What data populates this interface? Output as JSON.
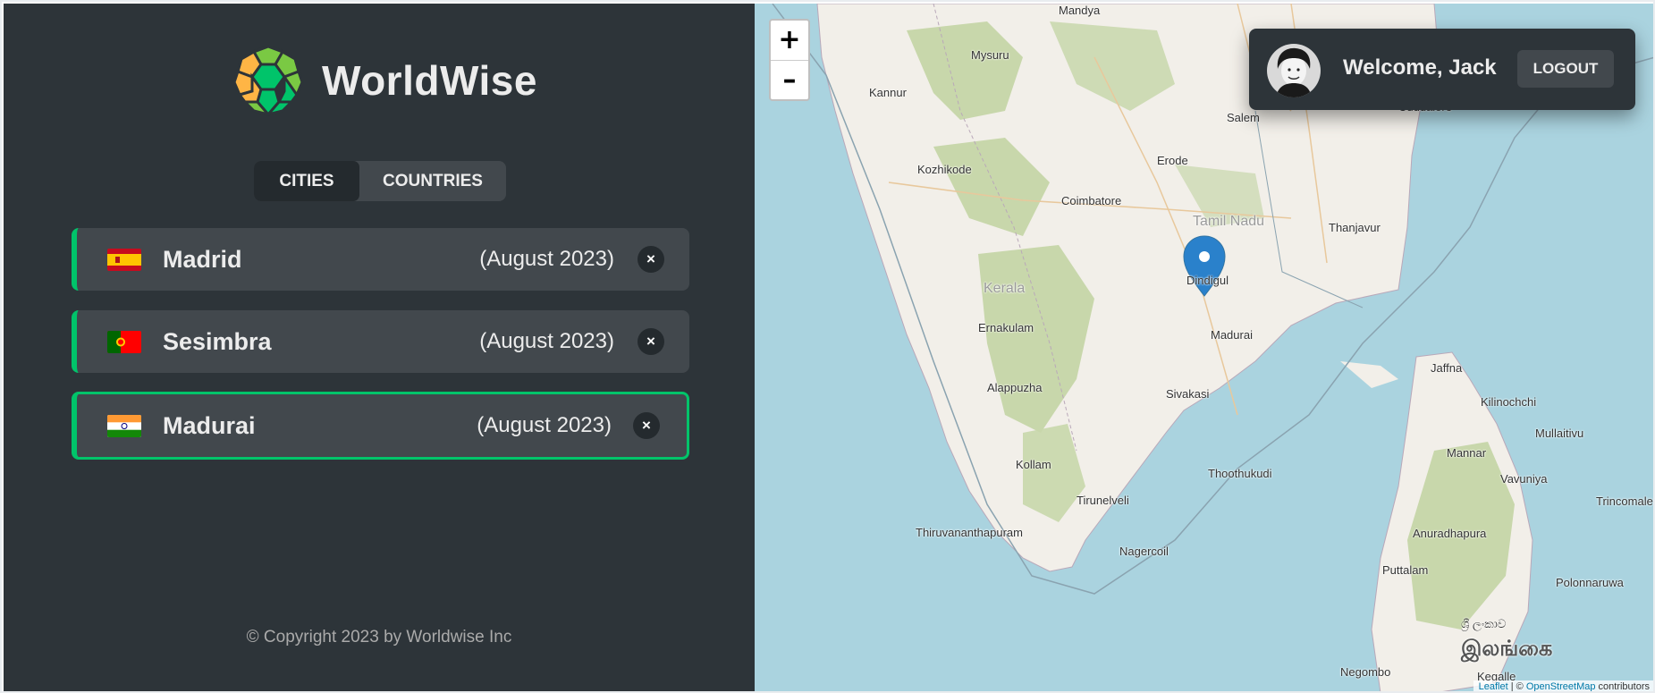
{
  "app": {
    "name": "WorldWise"
  },
  "tabs": [
    {
      "label": "Cities"
    },
    {
      "label": "Countries"
    }
  ],
  "cities": [
    {
      "name": "Madrid",
      "date": "(August 2023)",
      "delete": "×"
    },
    {
      "name": "Sesimbra",
      "date": "(August 2023)",
      "delete": "×"
    },
    {
      "name": "Madurai",
      "date": "(August 2023)",
      "delete": "×"
    }
  ],
  "footer": {
    "copyright": "© Copyright 2023 by Worldwise Inc"
  },
  "map": {
    "zoom_in": "+",
    "zoom_out": "–",
    "labels": [
      "Mandya",
      "Mysuru",
      "Kannur",
      "Salem",
      "Erode",
      "Kozhikode",
      "Coimbatore",
      "Tamil Nadu",
      "Thanjavur",
      "Kerala",
      "Dindigul",
      "Ernakulam",
      "Madurai",
      "Alappuzha",
      "Sivakasi",
      "Jaffna",
      "Kilinochchi",
      "Mullaitivu",
      "Mannar",
      "Vavuniya",
      "Kollam",
      "Thoothukudi",
      "Trincomale",
      "Tirunelveli",
      "Thiruvananthapuram",
      "Anuradhapura",
      "Nagercoil",
      "Puttalam",
      "Polonnaruwa",
      "ශ්‍රී ලංකාව",
      "இலங்கை",
      "Negombo",
      "Kegalle",
      "Cuddalore"
    ],
    "attribution": {
      "leaflet": "Leaflet",
      "separator": " | © ",
      "osm": "OpenStreetMap",
      "suffix": " contributors"
    }
  },
  "user": {
    "welcome": "Welcome, Jack",
    "logout": "Logout"
  },
  "colors": {
    "sidebar": "#2d3439",
    "panel": "#42484d",
    "accent": "#00c46a",
    "sea": "#aad3df",
    "land": "#f2efe9",
    "forest": "#c8d7ab",
    "marker": "#2a81cb"
  }
}
